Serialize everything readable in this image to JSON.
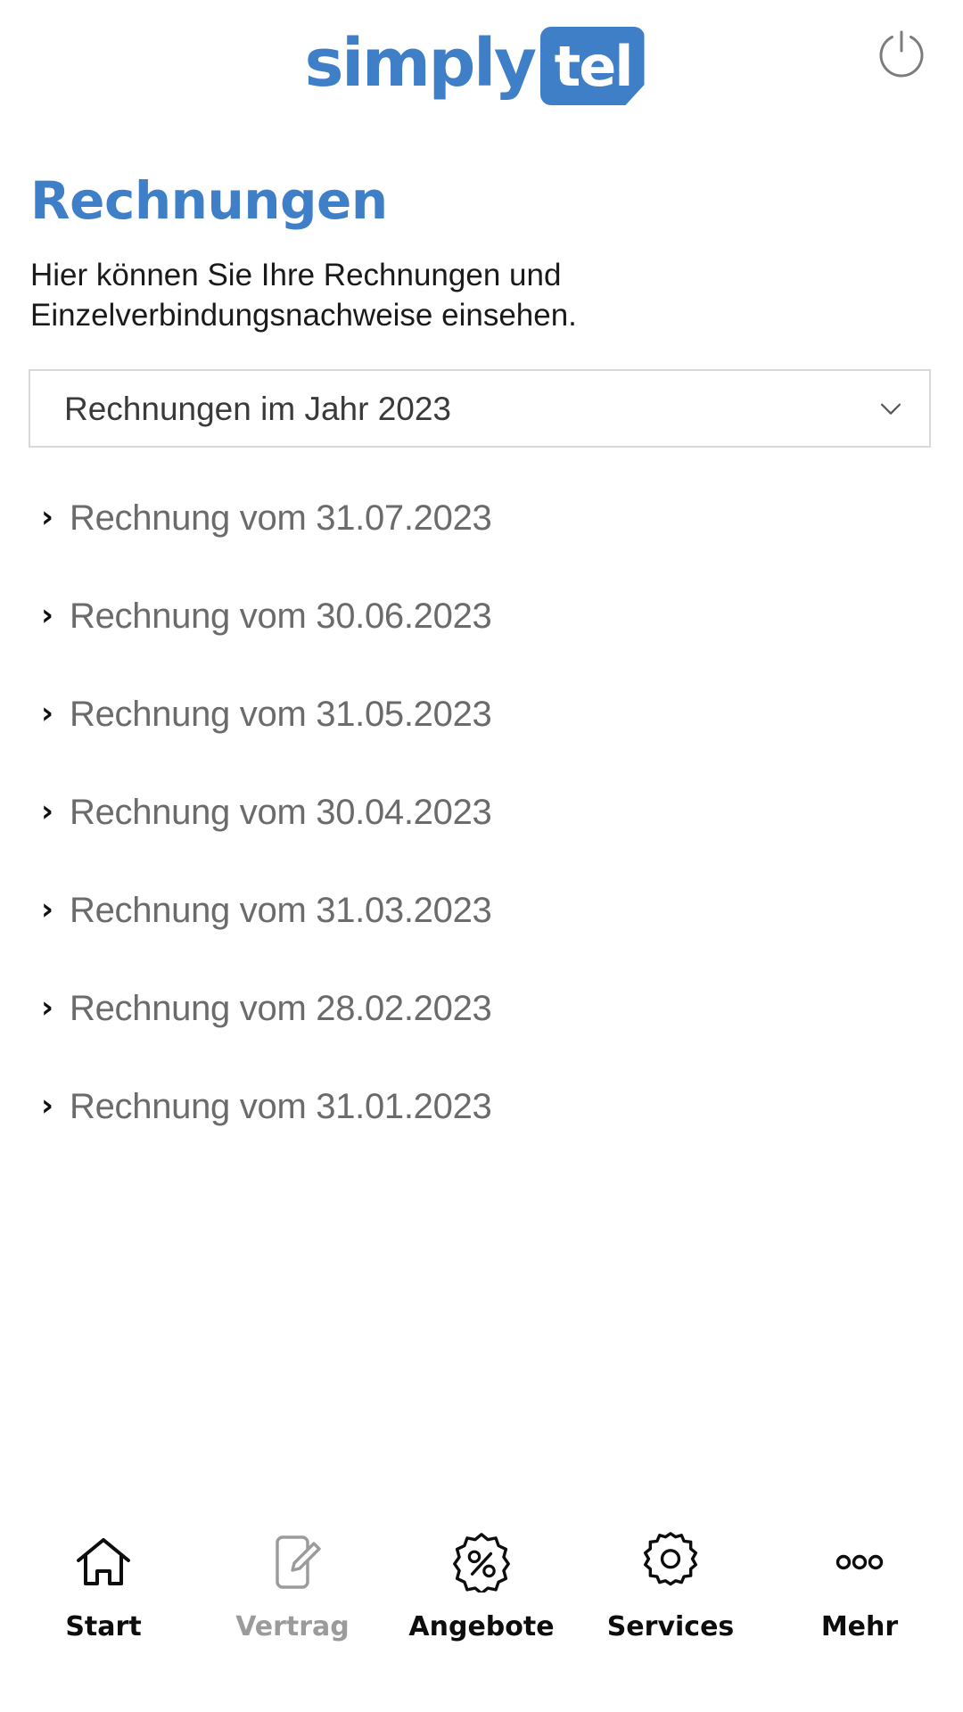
{
  "header": {
    "logo_word": "simply",
    "logo_badge": "tel",
    "power_icon": "power-icon"
  },
  "main": {
    "title": "Rechnungen",
    "description": "Hier können Sie Ihre Rechnungen und Einzelverbindungsnachweise einsehen.",
    "year_select": {
      "value": "Rechnungen im Jahr 2023",
      "chevron_icon": "chevron-down-icon",
      "options": [
        "Rechnungen im Jahr 2023"
      ]
    },
    "invoices": [
      {
        "label": "Rechnung vom 31.07.2023",
        "chevron": "›"
      },
      {
        "label": "Rechnung vom 30.06.2023",
        "chevron": "›"
      },
      {
        "label": "Rechnung vom 31.05.2023",
        "chevron": "›"
      },
      {
        "label": "Rechnung vom 30.04.2023",
        "chevron": "›"
      },
      {
        "label": "Rechnung vom 31.03.2023",
        "chevron": "›"
      },
      {
        "label": "Rechnung vom 28.02.2023",
        "chevron": "›"
      },
      {
        "label": "Rechnung vom 31.01.2023",
        "chevron": "›"
      }
    ]
  },
  "bottom_nav": {
    "items": [
      {
        "label": "Start",
        "icon": "home-icon",
        "state": "active"
      },
      {
        "label": "Vertrag",
        "icon": "document-edit-icon",
        "state": "inactive"
      },
      {
        "label": "Angebote",
        "icon": "discount-badge-icon",
        "state": "active"
      },
      {
        "label": "Services",
        "icon": "gear-icon",
        "state": "active"
      },
      {
        "label": "Mehr",
        "icon": "more-dots-icon",
        "state": "active"
      }
    ]
  },
  "colors": {
    "brand_blue": "#3f7fc7",
    "list_text": "#6b6b6b",
    "body_text": "#1a1a1a",
    "inactive": "#9b9b9b",
    "border": "#d8d8d8"
  }
}
